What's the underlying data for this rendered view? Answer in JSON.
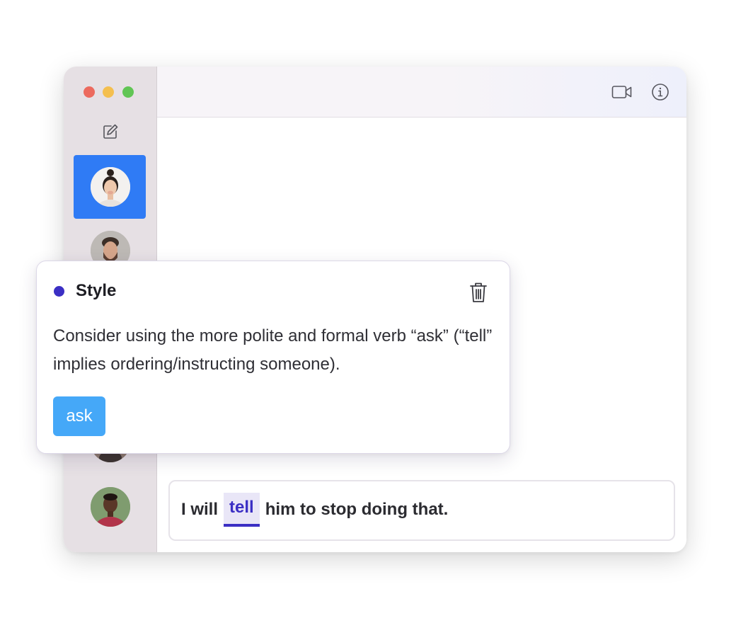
{
  "composer": {
    "text_before": "I will",
    "flagged_word": "tell",
    "text_after": "him to stop doing that."
  },
  "suggestion": {
    "category": "Style",
    "message": "Consider using the more polite and formal verb “ask” (“tell” implies ordering/instructing someone).",
    "replacement": "ask",
    "dot_color": "#3b2fc4"
  },
  "toolbar": {
    "icons": [
      "video-icon",
      "info-icon"
    ]
  },
  "sidebar": {
    "compose_icon": "compose-icon",
    "selected_contact": 0,
    "accent_color": "#2f7bf5"
  }
}
